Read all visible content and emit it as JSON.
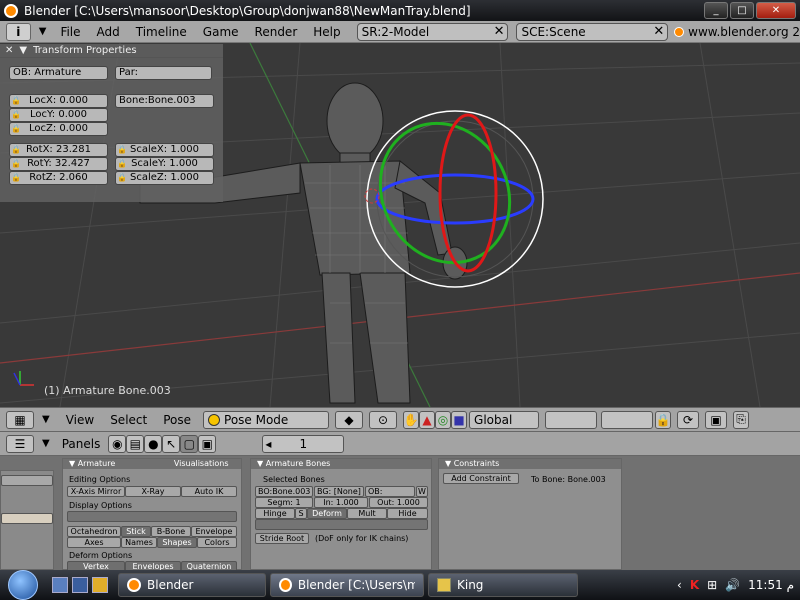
{
  "window": {
    "title": "Blender [C:\\Users\\mansoor\\Desktop\\Group\\donjwan88\\NewManTray.blend]",
    "controls": [
      "_",
      "□",
      "✕"
    ]
  },
  "menubar": {
    "info_icon": "i",
    "items": [
      "File",
      "Add",
      "Timeline",
      "Game",
      "Render",
      "Help"
    ],
    "screen_field": "SR:2-Model",
    "scene_field": "SCE:Scene",
    "site": "www.blender.org 2"
  },
  "transform_panel": {
    "title": "Transform Properties",
    "ob": "OB: Armature",
    "par": "Par:",
    "bone": "Bone:Bone.003",
    "loc": [
      "LocX: 0.000",
      "LocY: 0.000",
      "LocZ: 0.000"
    ],
    "rot": [
      "RotX: 23.281",
      "RotY: 32.427",
      "RotZ: 2.060"
    ],
    "scale": [
      "ScaleX: 1.000",
      "ScaleY: 1.000",
      "ScaleZ: 1.000"
    ]
  },
  "viewport": {
    "status": "(1) Armature Bone.003"
  },
  "header3d": {
    "view": "View",
    "select": "Select",
    "pose": "Pose",
    "mode": "Pose Mode",
    "orientation": "Global"
  },
  "buttons_window": {
    "panels_label": "Panels",
    "frame": "1",
    "armature": {
      "tab": "Armature",
      "tab2": "Visualisations",
      "editing_options": "Editing Options",
      "xaxis": "X-Axis Mirror",
      "xray": "X-Ray",
      "autoik": "Auto IK",
      "display_options": "Display Options",
      "octa": "Octahedron",
      "stick": "Stick",
      "bbone": "B-Bone",
      "envelope": "Envelope",
      "axes": "Axes",
      "names": "Names",
      "shapes": "Shapes",
      "colors": "Colors",
      "deform_options": "Deform Options",
      "vgroups": "Vertex Groups",
      "envelopes": "Envelopes",
      "quaternion": "Quaternion"
    },
    "bones": {
      "tab": "Armature Bones",
      "selected": "Selected Bones",
      "bo": "BO:Bone.003",
      "bg": "BG: [None]",
      "ob": "OB:",
      "w": "W",
      "segm": "Segm: 1",
      "in": "In: 1.000",
      "out": "Out: 1.000",
      "hinge": "Hinge",
      "s": "S",
      "deform": "Deform",
      "mult": "Mult",
      "hide": "Hide",
      "stride": "Stride Root",
      "dof": "(DoF only for IK chains)"
    },
    "constraints": {
      "tab": "Constraints",
      "add": "Add Constraint",
      "tobone": "To Bone: Bone.003"
    }
  },
  "taskbar": {
    "items": [
      "Blender",
      "Blender [C:\\Users\\m...",
      "King"
    ],
    "time": "11:51 م"
  }
}
